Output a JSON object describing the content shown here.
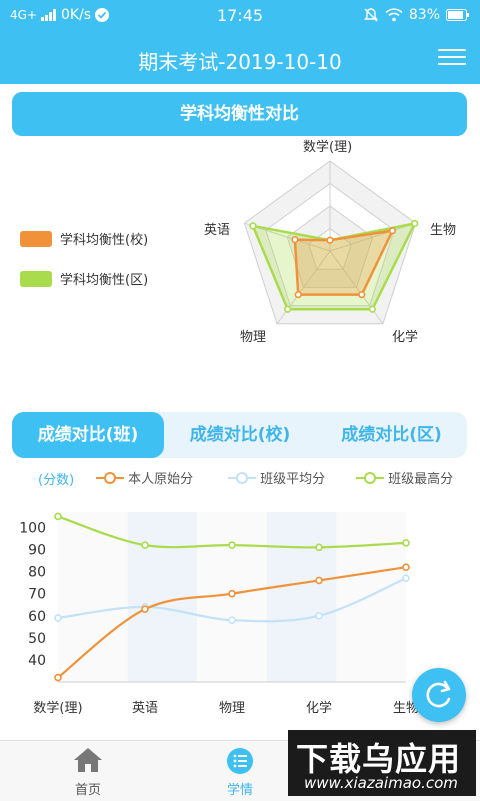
{
  "status_bar": {
    "network": "4G+",
    "speed": "0K/s",
    "time": "17:45",
    "battery": "83%"
  },
  "header": {
    "title": "期末考试-2019-10-10"
  },
  "balance_section": {
    "title": "学科均衡性对比"
  },
  "radar_legend": [
    {
      "label": "学科均衡性(校)",
      "color": "#f0923a"
    },
    {
      "label": "学科均衡性(区)",
      "color": "#a9dc4c"
    }
  ],
  "radar": {
    "axes": [
      "数学(理)",
      "生物",
      "化学",
      "物理",
      "英语"
    ],
    "series": [
      {
        "name": "学科均衡性(校)",
        "color": "#f0923a",
        "values": [
          0.12,
          0.73,
          0.6,
          0.6,
          0.41
        ]
      },
      {
        "name": "学科均衡性(区)",
        "color": "#a9dc4c",
        "values": [
          0.12,
          0.99,
          0.8,
          0.8,
          0.9
        ]
      }
    ],
    "levels": 4
  },
  "score_tabs": [
    {
      "label": "成绩对比(班)",
      "active": true
    },
    {
      "label": "成绩对比(校)",
      "active": false
    },
    {
      "label": "成绩对比(区)",
      "active": false
    }
  ],
  "line_legend": {
    "unit": "(分数)",
    "items": [
      "本人原始分",
      "班级平均分",
      "班级最高分"
    ]
  },
  "chart_data": {
    "type": "line",
    "categories": [
      "数学(理)",
      "英语",
      "物理",
      "化学",
      "生物"
    ],
    "ylim": [
      30,
      107
    ],
    "yticks": [
      40,
      50,
      60,
      70,
      80,
      90,
      100
    ],
    "series": [
      {
        "name": "本人原始分",
        "color": "#f0923a",
        "values": [
          32,
          63,
          70,
          76,
          82
        ]
      },
      {
        "name": "班级平均分",
        "color": "#c3e2f8",
        "values": [
          59,
          64,
          58,
          60,
          77
        ]
      },
      {
        "name": "班级最高分",
        "color": "#a9dc4c",
        "values": [
          105,
          92,
          92,
          91,
          93
        ]
      }
    ]
  },
  "bottom_nav": [
    {
      "label": "首页",
      "icon": "home-icon",
      "active": false
    },
    {
      "label": "学情",
      "icon": "list-icon",
      "active": true
    }
  ],
  "colors": {
    "primary": "#3fc0f2",
    "orange": "#f0923a",
    "green": "#a9dc4c",
    "light_blue": "#c3e2f8"
  },
  "watermark": {
    "text": "下载乌应用",
    "sub": "www.xiazaimao.com"
  }
}
